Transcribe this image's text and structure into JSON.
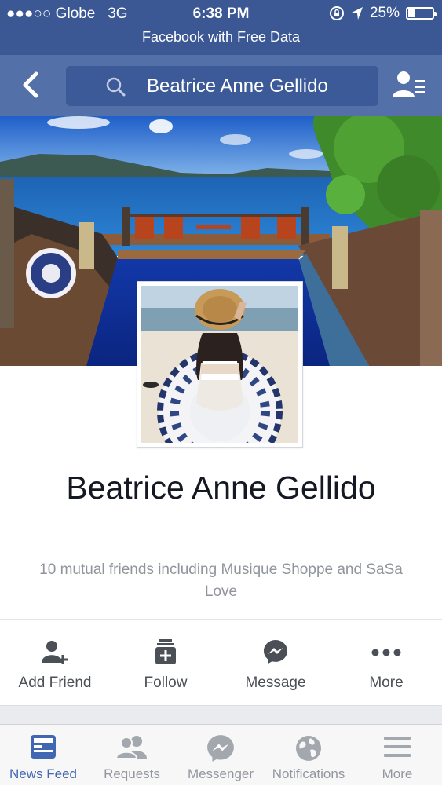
{
  "status_bar": {
    "carrier": "●●●○○ Globe",
    "network": "3G",
    "time": "6:38 PM",
    "battery": "25%",
    "battery_level": 0.25,
    "icons": [
      "orientation-lock-icon",
      "location-arrow-icon",
      "battery-icon"
    ]
  },
  "banner": {
    "text": "Facebook with Free Data"
  },
  "nav": {
    "search_text": "Beatrice Anne Gellido",
    "icons": [
      "back-chevron-icon",
      "search-icon",
      "friends-list-icon"
    ]
  },
  "profile": {
    "name": "Beatrice Anne Gellido",
    "mutual_friends": "10 mutual friends including Musique Shoppe and SaSa Love"
  },
  "actions": [
    {
      "label": "Add Friend",
      "icon": "add-friend-icon"
    },
    {
      "label": "Follow",
      "icon": "follow-icon"
    },
    {
      "label": "Message",
      "icon": "messenger-icon"
    },
    {
      "label": "More",
      "icon": "more-dots-icon"
    }
  ],
  "tabs": [
    {
      "label": "News Feed",
      "icon": "news-feed-icon",
      "active": true
    },
    {
      "label": "Requests",
      "icon": "requests-icon",
      "active": false
    },
    {
      "label": "Messenger",
      "icon": "messenger-icon",
      "active": false
    },
    {
      "label": "Notifications",
      "icon": "globe-icon",
      "active": false
    },
    {
      "label": "More",
      "icon": "menu-icon",
      "active": false
    }
  ],
  "colors": {
    "header": "#3b5894",
    "nav": "#5470a9",
    "accent": "#4267b2",
    "muted": "#92969f"
  }
}
